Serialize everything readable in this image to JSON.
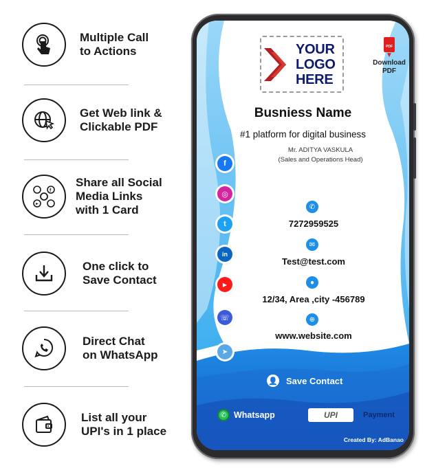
{
  "features": [
    {
      "label": "Multiple Call\nto Actions",
      "icon": "tap-hand-icon"
    },
    {
      "label": "Get Web link &\nClickable PDF",
      "icon": "globe-cursor-icon"
    },
    {
      "label": "Share all Social\nMedia Links\nwith 1 Card",
      "icon": "social-share-icon"
    },
    {
      "label": "One click to\nSave Contact",
      "icon": "download-icon"
    },
    {
      "label": "Direct Chat\non WhatsApp",
      "icon": "whatsapp-icon"
    },
    {
      "label": "List all your\nUPI's in 1 place",
      "icon": "wallet-icon"
    }
  ],
  "card": {
    "logo_text": "YOUR\nLOGO\nHERE",
    "pdf_badge": "PDF",
    "download_label": "Download\nPDF",
    "business_name": "Busniess Name",
    "tagline": "#1 platform for digital business",
    "person_name": "Mr. ADITYA VASKULA",
    "person_title": "(Sales and Operations Head)",
    "phone": "7272959525",
    "email": "Test@test.com",
    "address": "12/34, Area ,city -456789",
    "website": "www.website.com",
    "save_contact": "Save Contact",
    "whatsapp": "Whatsapp",
    "upi_logo": "UPI",
    "payment": "Payment",
    "credit": "Created By: AdBanao"
  },
  "social_icons": [
    {
      "name": "facebook-icon",
      "glyph": "f",
      "color": "#1877f2"
    },
    {
      "name": "instagram-icon",
      "glyph": "◎",
      "color": "#d6249f"
    },
    {
      "name": "twitter-icon",
      "glyph": "t",
      "color": "#1da1f2"
    },
    {
      "name": "linkedin-icon",
      "glyph": "in",
      "color": "#0a66c2"
    },
    {
      "name": "youtube-icon",
      "glyph": "▶",
      "color": "#ff1a1a"
    },
    {
      "name": "viber-icon",
      "glyph": "☏",
      "color": "#3b5bdb"
    },
    {
      "name": "telegram-icon",
      "glyph": "➤",
      "color": "#5aa9e6"
    }
  ],
  "colors": {
    "primary_blue": "#1b6fd0",
    "light_blue": "#29a9f0",
    "logo_red": "#b01f24",
    "logo_navy": "#0d1a6b",
    "whatsapp_green": "#25c25a"
  }
}
